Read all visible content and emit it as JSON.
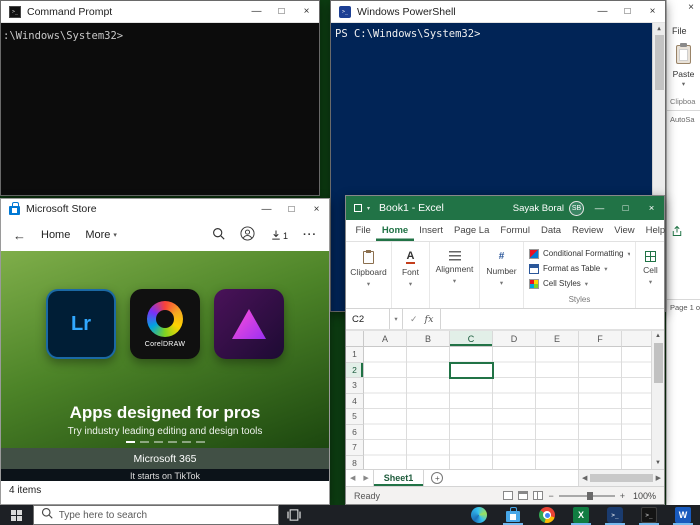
{
  "icons": {
    "minimize": "—",
    "maximize": "□",
    "close": "×",
    "chevron": "▾",
    "back": "←",
    "up": "▲",
    "down": "▼",
    "left": "◀",
    "right": "▶",
    "check": "✓",
    "fx": "fx",
    "ellipsis": "···",
    "plus": "+",
    "minus": "−",
    "font_a": "A",
    "number_sign": "#",
    "excel_x": "X",
    "terminal_glyph": ">_",
    "word_w": "W"
  },
  "cmd": {
    "title": "Command Prompt",
    "prompt": ":\\Windows\\System32>"
  },
  "powershell": {
    "title": "Windows PowerShell",
    "prompt": "PS C:\\Windows\\System32>"
  },
  "word": {
    "file": "File",
    "paste": "Paste",
    "clipboard_group": "Clipboa",
    "autosave": "AutoSa",
    "page_status": "Page 1 o"
  },
  "store": {
    "title": "Microsoft Store",
    "home": "Home",
    "more": "More",
    "download_badge": "1",
    "hero_title": "Apps designed for pros",
    "hero_subtitle": "Try industry leading editing and design tools",
    "tile_lr": "Lr",
    "tile_corel": "CorelDRAW",
    "banner_m365": "Microsoft 365",
    "banner_tiktok": "It starts on TikTok",
    "items_count": "4 items"
  },
  "excel": {
    "title": "Book1 - Excel",
    "user": "Sayak Boral",
    "user_initials": "SB",
    "tabs": [
      "File",
      "Home",
      "Insert",
      "Page La",
      "Formul",
      "Data",
      "Review",
      "View",
      "Help"
    ],
    "ribbon": {
      "clipboard": "Clipboard",
      "font": "Font",
      "alignment": "Alignment",
      "number": "Number",
      "conditional_formatting": "Conditional Formatting",
      "format_as_table": "Format as Table",
      "cell_styles": "Cell Styles",
      "styles_group": "Styles",
      "cells": "Cell"
    },
    "name_box": "C2",
    "columns": [
      "A",
      "B",
      "C",
      "D",
      "E",
      "F"
    ],
    "rows": [
      "1",
      "2",
      "3",
      "4",
      "5",
      "6",
      "7",
      "8"
    ],
    "sheet_tab": "Sheet1",
    "status": "Ready",
    "zoom": "100%"
  },
  "taskbar": {
    "search_placeholder": "Type here to search"
  }
}
